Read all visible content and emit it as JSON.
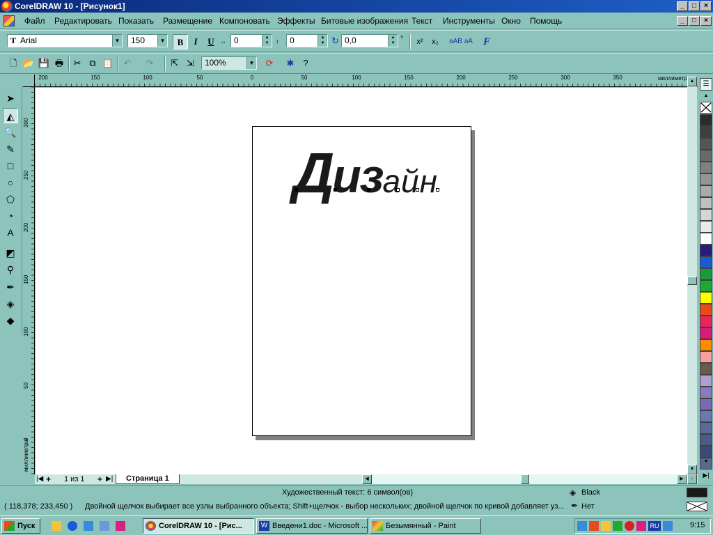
{
  "window": {
    "title": "CorelDRAW 10 - [Рисунок1]",
    "controls": [
      "_",
      "□",
      "×"
    ]
  },
  "menu": {
    "items": [
      "Файл",
      "Редактировать",
      "Показать",
      "Размещение",
      "Компоновать",
      "Эффекты",
      "Битовые изображения",
      "Текст",
      "Инструменты",
      "Окно",
      "Помощь"
    ]
  },
  "text_toolbar": {
    "font_name": "Arial",
    "font_size": "150",
    "bold": "B",
    "italic": "I",
    "underline": "U",
    "h_spacing": "0",
    "v_spacing": "0",
    "angle": "0,0",
    "degree": "°",
    "superscript": "x²",
    "subscript": "x₂",
    "case_label": "aAB aA",
    "format_label": "F"
  },
  "standard_toolbar": {
    "zoom": "100%"
  },
  "rulers": {
    "horizontal_labels": [
      "200",
      "150",
      "100",
      "50",
      "0",
      "50",
      "100",
      "150",
      "200",
      "250",
      "300",
      "350"
    ],
    "horizontal_unit": "миллиметры",
    "vertical_labels": [
      "300",
      "250",
      "200",
      "150",
      "100",
      "50",
      "0"
    ],
    "vertical_unit": "миллиметры"
  },
  "document": {
    "artistic_text": {
      "char1": "Д",
      "char2": "и",
      "char3": "з",
      "rest": "айн"
    }
  },
  "page_nav": {
    "page_count": "1 из 1",
    "page_tab": "Страница 1"
  },
  "status": {
    "object_info": "Художественный текст: 6 символ(ов)",
    "coordinates": "( 118,378; 233,450 )",
    "hint": "Двойной щелчок выбирает все узлы выбранного объекта; Shift+щелчок - выбор нескольких; двойной щелчок по кривой добавляет уз...",
    "fill_label": "Black",
    "outline_label": "Нет",
    "fill_color": "#1a1a1a"
  },
  "palette": {
    "colors": [
      "#2b2b2b",
      "#3f3f3f",
      "#555555",
      "#6a6a6a",
      "#808080",
      "#959595",
      "#aaaaaa",
      "#c0c0c0",
      "#d5d5d5",
      "#eaeaea",
      "#ffffff",
      "#2a1a7a",
      "#1a5ad8",
      "#1a9a3a",
      "#20a830",
      "#ffff00",
      "#e84a1a",
      "#e8245a",
      "#d81a7a",
      "#ff8a00",
      "#f8a0a0",
      "#6a5a4a",
      "#b0a0d0",
      "#8a7ac0",
      "#7a6ab0",
      "#6a7ab0",
      "#5a6a9a",
      "#4a5a8a",
      "#3a4a7a",
      "#5a6a8a"
    ]
  },
  "taskbar": {
    "start_label": "Пуск",
    "tasks": [
      "CorelDRAW 10 - [Рис...",
      "Введени1.doc - Microsoft ...",
      "Безымянный - Paint"
    ],
    "time": "9:15",
    "lang": "RU"
  }
}
